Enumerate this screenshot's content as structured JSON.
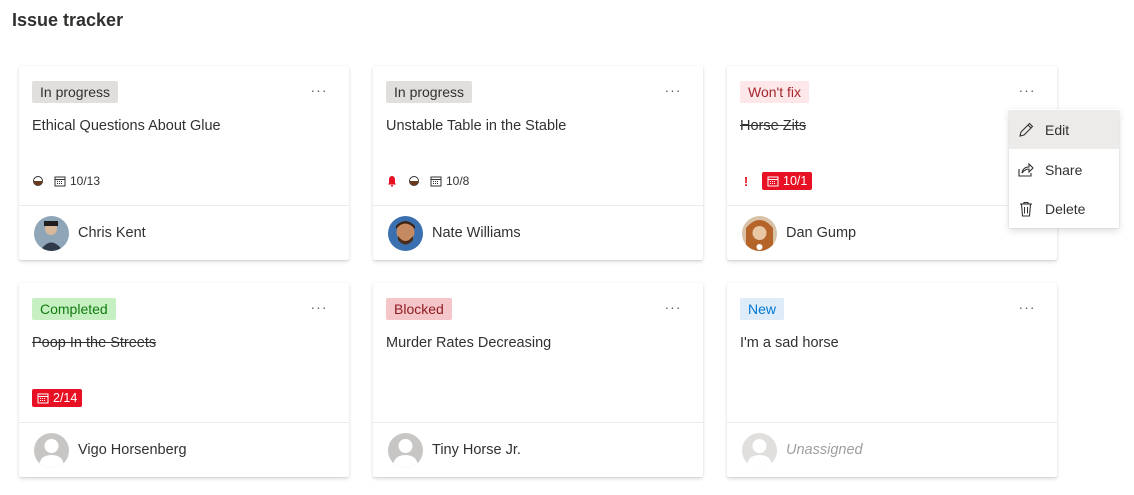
{
  "header": {
    "title": "Issue tracker"
  },
  "cards": [
    {
      "status": "In progress",
      "more": "···",
      "title": "Ethical Questions About Glue",
      "due": "10/13",
      "assignee": "Chris Kent"
    },
    {
      "status": "In progress",
      "more": "···",
      "title": "Unstable Table in the Stable",
      "due": "10/8",
      "assignee": "Nate Williams"
    },
    {
      "status": "Won't fix",
      "more": "···",
      "title": "Horse Zits",
      "priority": "!",
      "due": "10/1",
      "assignee": "Dan Gump"
    },
    {
      "status": "Completed",
      "more": "···",
      "title": "Poop In the Streets",
      "due": "2/14",
      "assignee": "Vigo Horsenberg"
    },
    {
      "status": "Blocked",
      "more": "···",
      "title": "Murder Rates Decreasing",
      "assignee": "Tiny Horse Jr."
    },
    {
      "status": "New",
      "more": "···",
      "title": "I'm a sad horse",
      "assignee": "Unassigned"
    }
  ],
  "context_menu": {
    "items": [
      {
        "label": "Edit"
      },
      {
        "label": "Share"
      },
      {
        "label": "Delete"
      }
    ]
  },
  "colors": {
    "accent": "#0078d4",
    "overdue": "#e81123",
    "completed_bg": "#c7f0c2",
    "blocked_bg": "#f4c6c9",
    "wontfix_bg": "#fde7e9",
    "new_bg": "#deecf9"
  }
}
